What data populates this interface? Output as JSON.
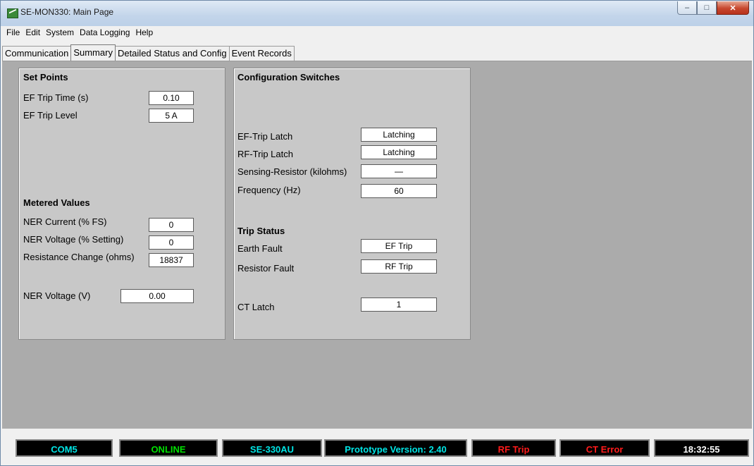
{
  "window": {
    "title": "SE-MON330: Main Page"
  },
  "menu": [
    "File",
    "Edit",
    "System",
    "Data Logging",
    "Help"
  ],
  "tabs": [
    {
      "label": "Communication",
      "active": false
    },
    {
      "label": "Summary",
      "active": true
    },
    {
      "label": "Detailed Status and Config",
      "active": false
    },
    {
      "label": "Event Records",
      "active": false
    }
  ],
  "set_points": {
    "heading": "Set Points",
    "ef_trip_time": {
      "label": "EF Trip Time (s)",
      "value": "0.10"
    },
    "ef_trip_level": {
      "label": "EF Trip Level",
      "value": "5 A"
    }
  },
  "metered": {
    "heading": "Metered Values",
    "ner_current": {
      "label": "NER Current (% FS)",
      "value": "0"
    },
    "ner_voltage_pct": {
      "label": "NER Voltage (% Setting)",
      "value": "0"
    },
    "resistance_change": {
      "label": "Resistance Change (ohms)",
      "value": "18837"
    },
    "ner_voltage_v": {
      "label": "NER Voltage (V)",
      "value": "0.00"
    }
  },
  "config": {
    "heading": "Configuration Switches",
    "ef_trip_latch": {
      "label": "EF-Trip Latch",
      "value": "Latching"
    },
    "rf_trip_latch": {
      "label": "RF-Trip Latch",
      "value": "Latching"
    },
    "sensing_resistor": {
      "label": "Sensing-Resistor (kilohms)",
      "value": "—"
    },
    "frequency": {
      "label": "Frequency (Hz)",
      "value": "60"
    }
  },
  "trip_status": {
    "heading": "Trip Status",
    "earth_fault": {
      "label": "Earth Fault",
      "value": "EF Trip"
    },
    "resistor_fault": {
      "label": "Resistor Fault",
      "value": "RF Trip"
    },
    "ct_latch": {
      "label": "CT Latch",
      "value": "1"
    }
  },
  "status": {
    "port": "COM5",
    "connection": "ONLINE",
    "model": "SE-330AU",
    "version": "Prototype Version: 2.40",
    "rf_trip": "RF Trip",
    "ct_error": "CT Error",
    "clock": "18:32:55"
  },
  "colors": {
    "green": "#00e000",
    "cyan": "#00e5e5",
    "red": "#ff1a1a",
    "white": "#ffffff"
  }
}
